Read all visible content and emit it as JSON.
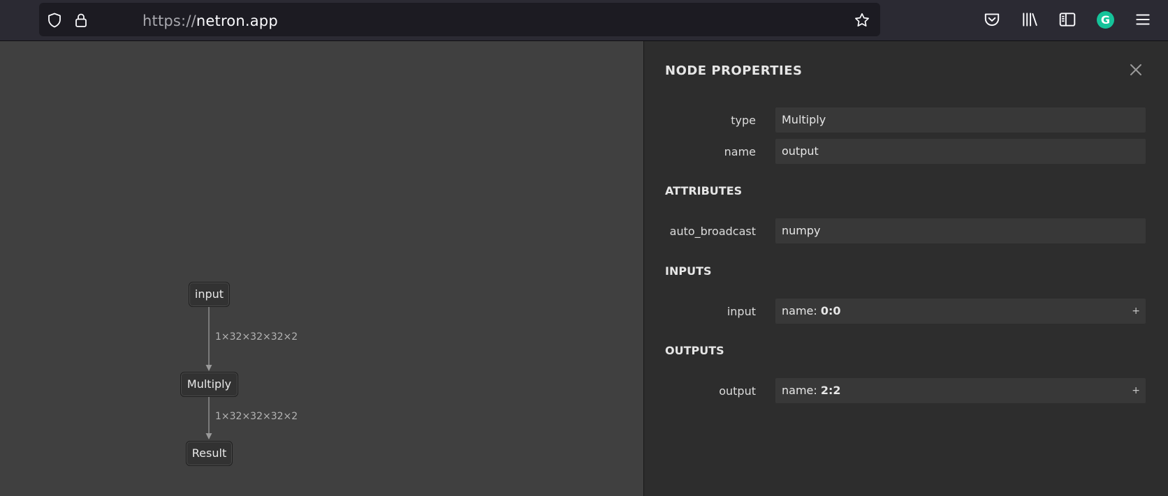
{
  "browser": {
    "url_scheme": "https://",
    "url_host": "netron.app",
    "grammarly_letter": "G"
  },
  "graph": {
    "nodes": {
      "input": "input",
      "multiply": "Multiply",
      "result": "Result"
    },
    "edges": {
      "input_to_multiply": "1×32×32×32×2",
      "multiply_to_result": "1×32×32×32×2"
    }
  },
  "panel": {
    "title": "NODE PROPERTIES",
    "properties": {
      "type_label": "type",
      "type_value": "Multiply",
      "name_label": "name",
      "name_value": "output"
    },
    "attributes": {
      "title": "ATTRIBUTES",
      "auto_broadcast_label": "auto_broadcast",
      "auto_broadcast_value": "numpy"
    },
    "inputs": {
      "title": "INPUTS",
      "input_label": "input",
      "input_prefix": "name: ",
      "input_value": "0:0",
      "expand": "+"
    },
    "outputs": {
      "title": "OUTPUTS",
      "output_label": "output",
      "output_prefix": "name: ",
      "output_value": "2:2",
      "expand": "+"
    }
  },
  "colors": {
    "canvas": "#404040",
    "panel": "#2d2d2d",
    "toolbar": "#2b2a33",
    "grammarly": "#15c39a"
  }
}
